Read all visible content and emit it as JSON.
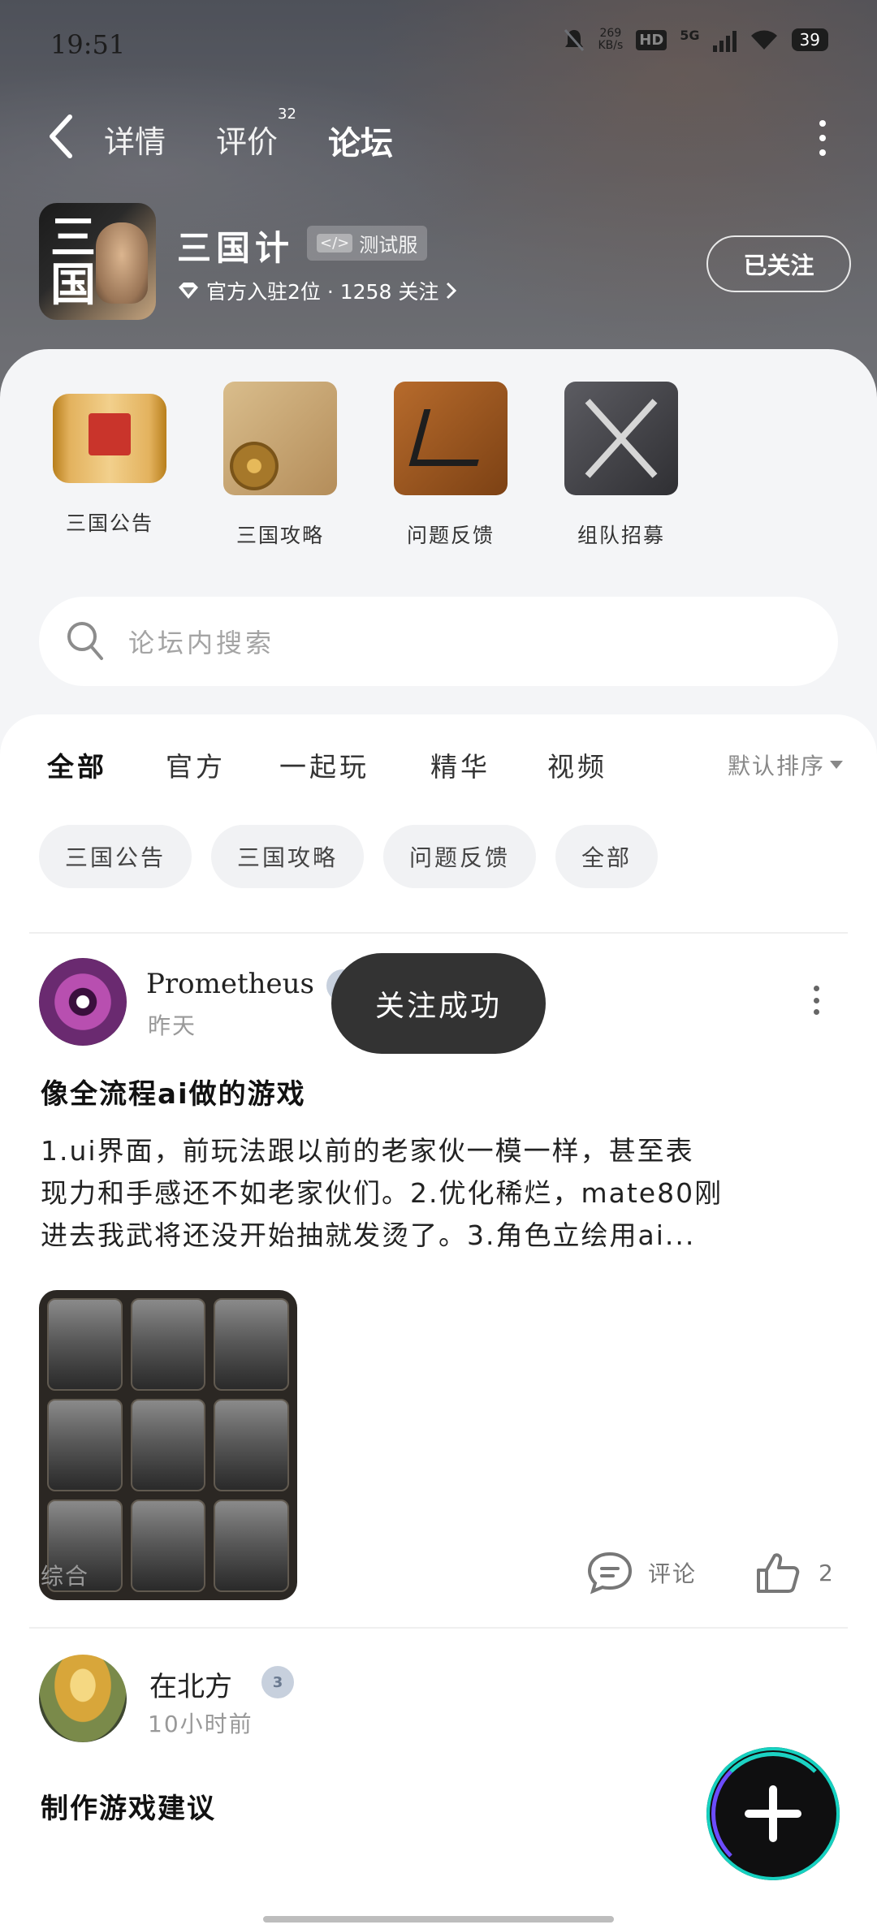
{
  "status_bar": {
    "time": "19:51",
    "net_speed_value": "269",
    "net_speed_unit": "KB/s",
    "hd_label": "HD",
    "network": "5G",
    "battery": "39"
  },
  "nav": {
    "tab_detail": "详情",
    "tab_review": "评价",
    "review_count": "32",
    "tab_forum": "论坛"
  },
  "game": {
    "logo_text": "三国",
    "name": "三国计",
    "badge_icon": "</>",
    "badge_label": "测试服",
    "meta_text": "官方入驻2位 · 1258 关注",
    "follow_label": "已关注"
  },
  "quick_entries": [
    {
      "label": "三国公告",
      "icon": "scroll-icon"
    },
    {
      "label": "三国攻略",
      "icon": "map-icon"
    },
    {
      "label": "问题反馈",
      "icon": "calligraphy-icon"
    },
    {
      "label": "组队招募",
      "icon": "weapons-icon"
    }
  ],
  "search": {
    "placeholder": "论坛内搜索"
  },
  "filter_tabs": [
    "全部",
    "官方",
    "一起玩",
    "精华",
    "视频"
  ],
  "sort_label": "默认排序",
  "chips": [
    "三国公告",
    "三国攻略",
    "问题反馈",
    "全部"
  ],
  "posts": [
    {
      "author": "Prometheus",
      "time": "昨天",
      "title": "像全流程ai做的游戏",
      "body_line1": "1.ui界面，前玩法跟以前的老家伙一模一样，甚至表",
      "body_line2": "现力和手感还不如老家伙们。2.优化稀烂，mate80刚",
      "body_line3": "进去我武将还没开始抽就发烫了。3.角色立绘用ai...",
      "category": "综合",
      "comment_label": "评论",
      "likes": "2"
    },
    {
      "author": "在北方",
      "level": "3",
      "time": "10小时前",
      "title": "制作游戏建议"
    }
  ],
  "toast": "关注成功",
  "colors": {
    "accent": "#2ec7b7",
    "fab_accent": "#6c4cff"
  }
}
